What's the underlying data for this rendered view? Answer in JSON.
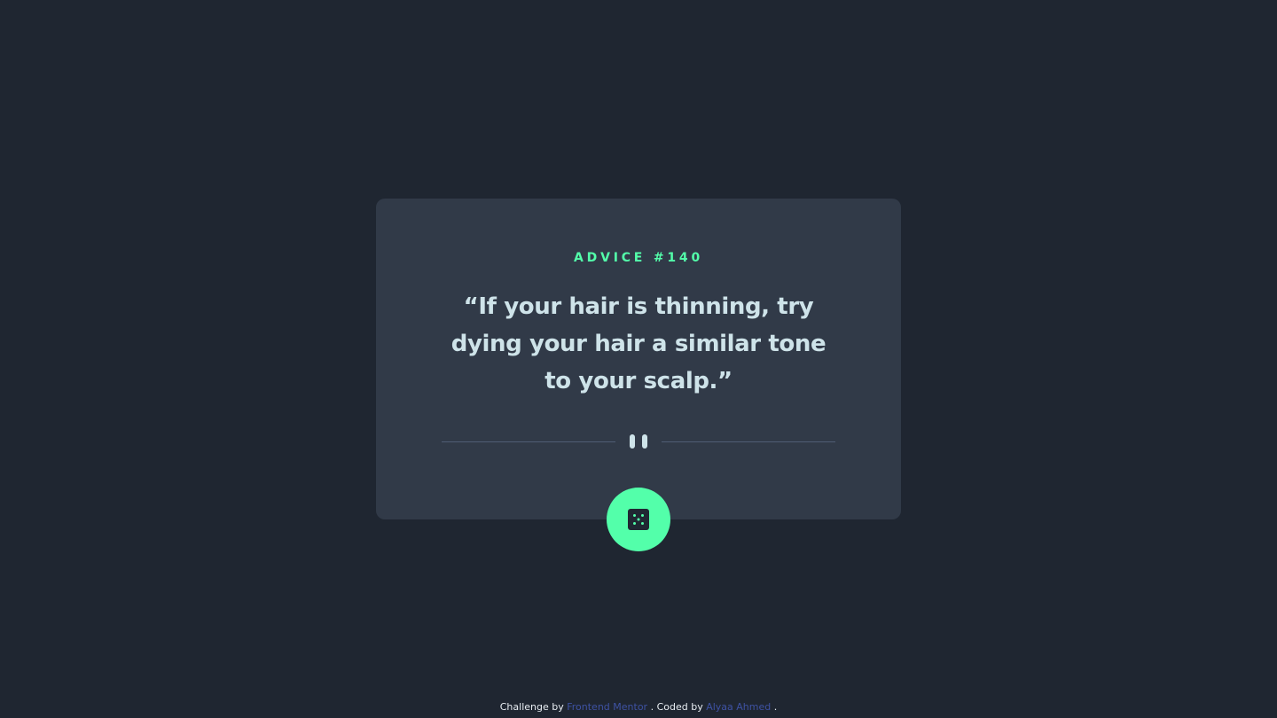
{
  "card": {
    "advice_label": "ADVICE #140",
    "quote": "“If your hair is thinning, try dying your hair a similar tone to your scalp.”",
    "divider_icon": "pause-icon",
    "button_icon": "dice-icon"
  },
  "footer": {
    "challenge_prefix": "Challenge by",
    "challenge_link": "Frontend Mentor",
    "coded_prefix": ". Coded by",
    "author_link": "Alyaa Ahmed",
    "suffix": "."
  },
  "colors": {
    "background": "#1f2631",
    "card": "#313a48",
    "accent": "#53ffaa",
    "text": "#cee3e9",
    "divider": "#4f5d74",
    "link": "#3e52a3"
  }
}
